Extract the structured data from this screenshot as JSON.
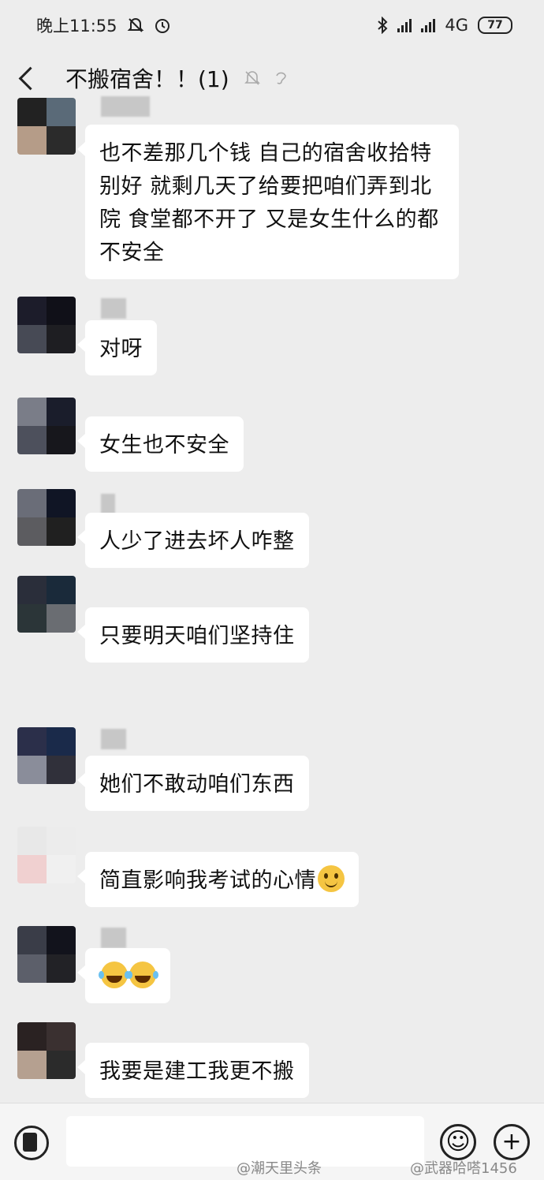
{
  "status_bar": {
    "time": "晚上11:55",
    "network": "4G",
    "battery": "77"
  },
  "header": {
    "title": "不搬宿舍！！(1)"
  },
  "messages": [
    {
      "text": "也不差那几个钱 自己的宿舍收拾特别好 就剩几天了给要把咱们弄到北院 食堂都不开了  又是女生什么的都不安全",
      "avatar_colors": [
        "#222222",
        "#5a6a78",
        "#b59c88",
        "#2b2b2b"
      ]
    },
    {
      "text": "对呀",
      "avatar_colors": [
        "#1c1c2a",
        "#101018",
        "#474a55",
        "#1e1e22"
      ]
    },
    {
      "text": "女生也不安全",
      "avatar_colors": [
        "#7a7d88",
        "#1a1d2b",
        "#4d505c",
        "#17171c"
      ]
    },
    {
      "text": "人少了进去坏人咋整",
      "avatar_colors": [
        "#6a6d78",
        "#101525",
        "#5c5c60",
        "#202020"
      ]
    },
    {
      "text": "只要明天咱们坚持住",
      "avatar_colors": [
        "#2a2e3a",
        "#1a2a3a",
        "#2b3538",
        "#6a6d72"
      ]
    },
    {
      "text": "她们不敢动咱们东西",
      "avatar_colors": [
        "#2b2f4a",
        "#1a2a4a",
        "#8a8d9a",
        "#30303a"
      ]
    },
    {
      "text": "简直影响我考试的心情",
      "emoji": "smile",
      "avatar_colors": [
        "#e8e8e8",
        "#ececec",
        "#f0d0d0",
        "#f0f0f0"
      ]
    },
    {
      "text": "",
      "emoji_pair": "laugh",
      "avatar_colors": [
        "#3a3d48",
        "#12131c",
        "#5c5f6a",
        "#222226"
      ]
    },
    {
      "text": "我要是建工我更不搬",
      "avatar_colors": [
        "#2a2222",
        "#3a3030",
        "#b5a090",
        "#2b2b2b"
      ]
    }
  ],
  "input_bar": {
    "emoji_button": "☺",
    "plus_button": "+"
  },
  "watermarks": {
    "left": "@潮天里头条",
    "right": "@武器哈嗒1456"
  },
  "icons": [
    "back-icon",
    "mute-bell-icon",
    "ear-icon",
    "voice-icon",
    "emoji-icon",
    "plus-icon",
    "bluetooth-icon",
    "alarm-icon"
  ]
}
